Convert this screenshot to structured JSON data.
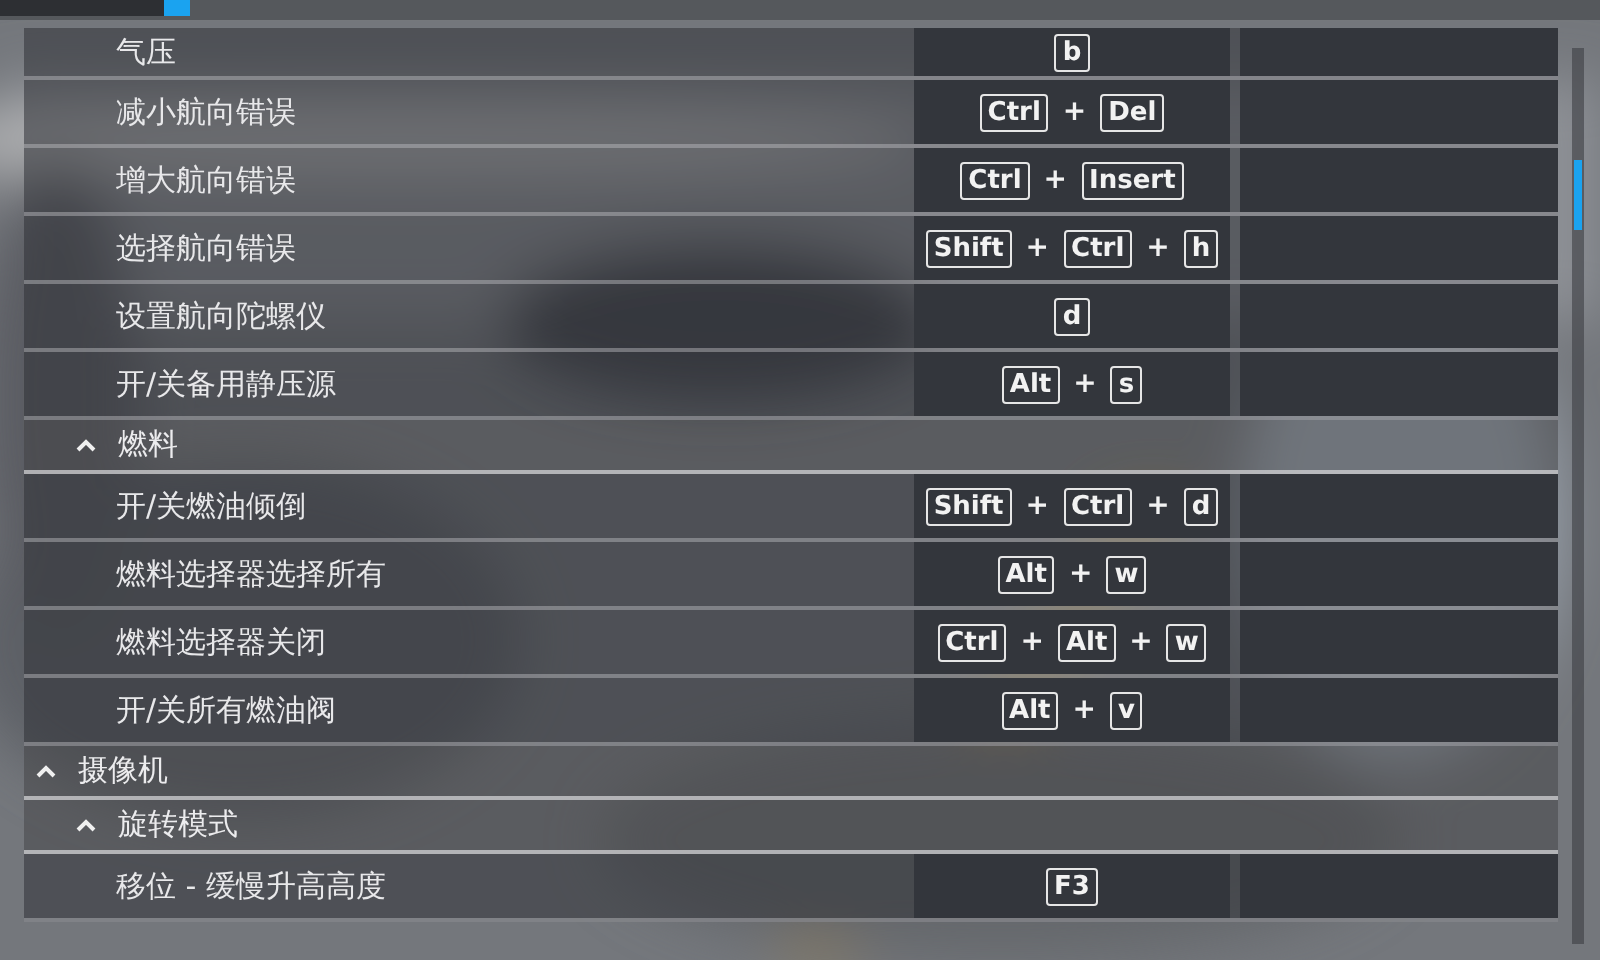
{
  "continued_section": {
    "items": [
      {
        "kind": "action",
        "label": "气压",
        "shortcut": [
          "b"
        ]
      },
      {
        "kind": "action",
        "label": "减小航向错误",
        "shortcut": [
          "Ctrl",
          "+",
          "Del"
        ]
      },
      {
        "kind": "action",
        "label": "增大航向错误",
        "shortcut": [
          "Ctrl",
          "+",
          "Insert"
        ]
      },
      {
        "kind": "action",
        "label": "选择航向错误",
        "shortcut": [
          "Shift",
          "+",
          "Ctrl",
          "+",
          "h"
        ]
      },
      {
        "kind": "action",
        "label": "设置航向陀螺仪",
        "shortcut": [
          "d"
        ]
      },
      {
        "kind": "action",
        "label": "开/关备用静压源",
        "shortcut": [
          "Alt",
          "+",
          "s"
        ]
      },
      {
        "kind": "group",
        "label": "燃料",
        "expanded": true,
        "children": [
          {
            "kind": "action",
            "label": "开/关燃油倾倒",
            "shortcut": [
              "Shift",
              "+",
              "Ctrl",
              "+",
              "d"
            ]
          },
          {
            "kind": "action",
            "label": "燃料选择器选择所有",
            "shortcut": [
              "Alt",
              "+",
              "w"
            ]
          },
          {
            "kind": "action",
            "label": "燃料选择器关闭",
            "shortcut": [
              "Ctrl",
              "+",
              "Alt",
              "+",
              "w"
            ]
          },
          {
            "kind": "action",
            "label": "开/关所有燃油阀",
            "shortcut": [
              "Alt",
              "+",
              "v"
            ]
          }
        ]
      }
    ]
  },
  "tree": [
    {
      "kind": "group",
      "label": "摄像机",
      "expanded": true,
      "children": [
        {
          "kind": "group",
          "label": "旋转模式",
          "expanded": true,
          "children": [
            {
              "kind": "action",
              "label": "移位 - 缓慢升高高度",
              "shortcut": [
                "F3"
              ]
            }
          ]
        }
      ]
    }
  ]
}
